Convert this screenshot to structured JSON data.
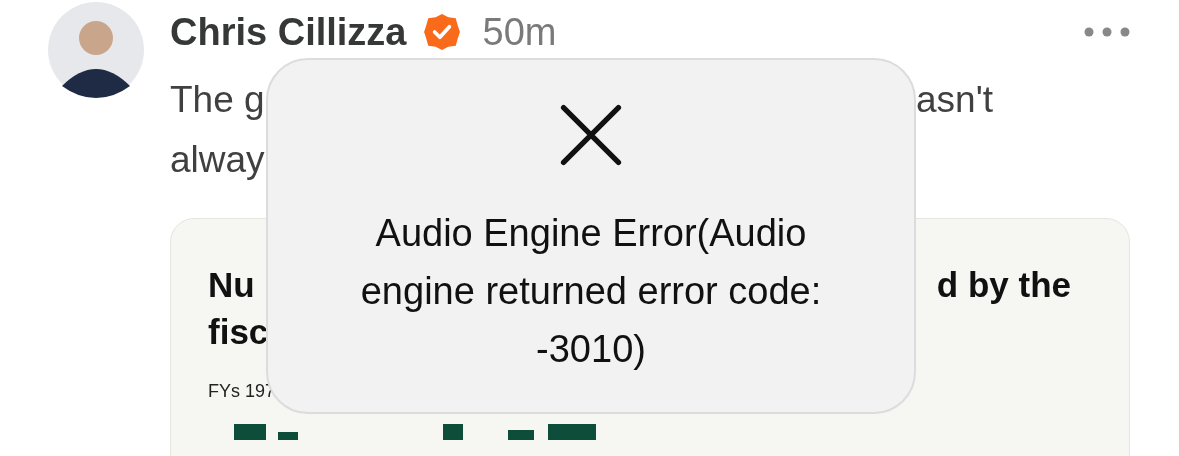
{
  "post": {
    "author": "Chris Cillizza",
    "verified": true,
    "time": "50m",
    "body_lines": [
      {
        "left": "The g",
        "right": "asn't"
      },
      {
        "left": "alway"
      }
    ],
    "card": {
      "title_lines": [
        {
          "left": "Nu",
          "right": "d by the"
        },
        {
          "left": "fisc"
        }
      ],
      "subtitle": "FYs 197"
    }
  },
  "alert": {
    "message_lines": [
      "Audio Engine Error(Audio",
      "engine returned error code:",
      "-3010)"
    ]
  }
}
